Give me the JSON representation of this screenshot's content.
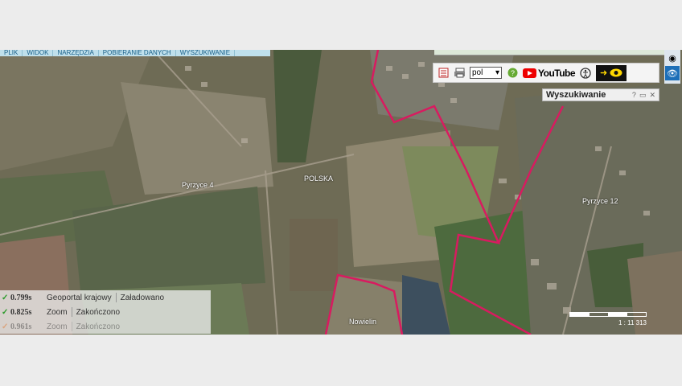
{
  "menu": {
    "items": [
      "PLIK",
      "WIDOK",
      "NARZĘDZIA",
      "POBIERANIE DANYCH",
      "WYSZUKIWANIE"
    ]
  },
  "toolbar": {
    "language": "pol",
    "youtube_label": "YouTube",
    "icons": [
      "legend-icon",
      "print-icon",
      "help-icon",
      "accessibility-icon",
      "eye-icon"
    ]
  },
  "search_panel": {
    "title": "Wyszukiwanie",
    "help": "?",
    "minimize": "▭",
    "close": "✕"
  },
  "map": {
    "labels": {
      "pyrzyce4": "Pyrzyce 4",
      "polska": "POLSKA",
      "pyrzyce12": "Pyrzyce 12",
      "nowielin": "Nowielin"
    },
    "boundary_color": "#d81b60"
  },
  "log": [
    {
      "time": "0.799s",
      "action": "Geoportal krajowy",
      "status": "Załadowano",
      "ok_color": "#2a9a2a"
    },
    {
      "time": "0.825s",
      "action": "Zoom",
      "status": "Zakończono",
      "ok_color": "#2a9a2a"
    },
    {
      "time": "0.961s",
      "action": "Zoom",
      "status": "Zakończono",
      "ok_color": "#e07020"
    }
  ],
  "scale": {
    "label": "1 : 11 313"
  }
}
